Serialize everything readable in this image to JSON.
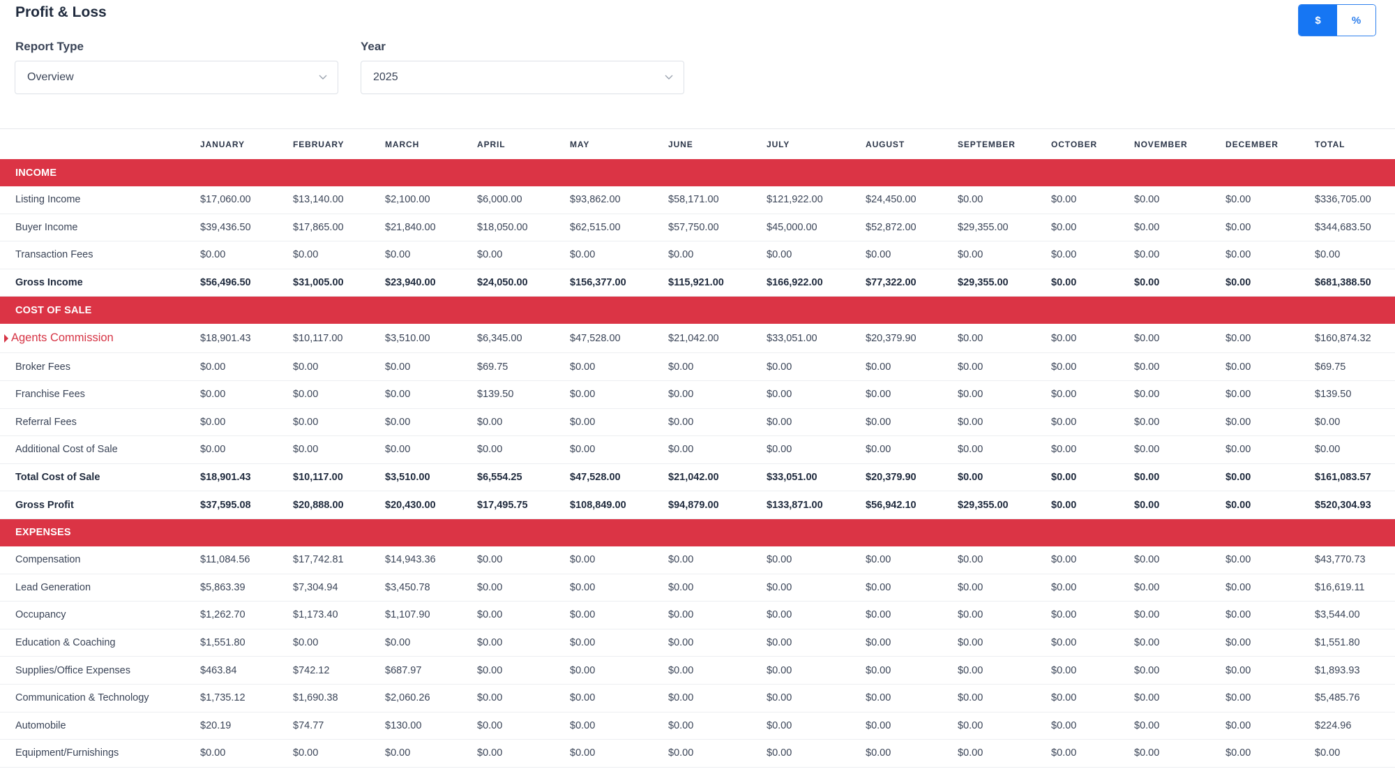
{
  "page": {
    "title": "Profit & Loss"
  },
  "toggle": {
    "dollar_label": "$",
    "percent_label": "%",
    "active": "$"
  },
  "filters": {
    "report_type_label": "Report Type",
    "report_type_value": "Overview",
    "year_label": "Year",
    "year_value": "2025"
  },
  "table": {
    "columns": [
      "JANUARY",
      "FEBRUARY",
      "MARCH",
      "APRIL",
      "MAY",
      "JUNE",
      "JULY",
      "AUGUST",
      "SEPTEMBER",
      "OCTOBER",
      "NOVEMBER",
      "DECEMBER",
      "TOTAL"
    ],
    "rows": [
      {
        "kind": "section",
        "label": "INCOME"
      },
      {
        "kind": "data",
        "label": "Listing Income",
        "values": [
          "$17,060.00",
          "$13,140.00",
          "$2,100.00",
          "$6,000.00",
          "$93,862.00",
          "$58,171.00",
          "$121,922.00",
          "$24,450.00",
          "$0.00",
          "$0.00",
          "$0.00",
          "$0.00",
          "$336,705.00"
        ]
      },
      {
        "kind": "data",
        "label": "Buyer Income",
        "values": [
          "$39,436.50",
          "$17,865.00",
          "$21,840.00",
          "$18,050.00",
          "$62,515.00",
          "$57,750.00",
          "$45,000.00",
          "$52,872.00",
          "$29,355.00",
          "$0.00",
          "$0.00",
          "$0.00",
          "$344,683.50"
        ]
      },
      {
        "kind": "data",
        "label": "Transaction Fees",
        "values": [
          "$0.00",
          "$0.00",
          "$0.00",
          "$0.00",
          "$0.00",
          "$0.00",
          "$0.00",
          "$0.00",
          "$0.00",
          "$0.00",
          "$0.00",
          "$0.00",
          "$0.00"
        ]
      },
      {
        "kind": "total",
        "label": "Gross Income",
        "values": [
          "$56,496.50",
          "$31,005.00",
          "$23,940.00",
          "$24,050.00",
          "$156,377.00",
          "$115,921.00",
          "$166,922.00",
          "$77,322.00",
          "$29,355.00",
          "$0.00",
          "$0.00",
          "$0.00",
          "$681,388.50"
        ]
      },
      {
        "kind": "section",
        "label": "COST OF SALE"
      },
      {
        "kind": "expandable",
        "label": "Agents Commission",
        "values": [
          "$18,901.43",
          "$10,117.00",
          "$3,510.00",
          "$6,345.00",
          "$47,528.00",
          "$21,042.00",
          "$33,051.00",
          "$20,379.90",
          "$0.00",
          "$0.00",
          "$0.00",
          "$0.00",
          "$160,874.32"
        ]
      },
      {
        "kind": "data",
        "label": "Broker Fees",
        "values": [
          "$0.00",
          "$0.00",
          "$0.00",
          "$69.75",
          "$0.00",
          "$0.00",
          "$0.00",
          "$0.00",
          "$0.00",
          "$0.00",
          "$0.00",
          "$0.00",
          "$69.75"
        ]
      },
      {
        "kind": "data",
        "label": "Franchise Fees",
        "values": [
          "$0.00",
          "$0.00",
          "$0.00",
          "$139.50",
          "$0.00",
          "$0.00",
          "$0.00",
          "$0.00",
          "$0.00",
          "$0.00",
          "$0.00",
          "$0.00",
          "$139.50"
        ]
      },
      {
        "kind": "data",
        "label": "Referral Fees",
        "values": [
          "$0.00",
          "$0.00",
          "$0.00",
          "$0.00",
          "$0.00",
          "$0.00",
          "$0.00",
          "$0.00",
          "$0.00",
          "$0.00",
          "$0.00",
          "$0.00",
          "$0.00"
        ]
      },
      {
        "kind": "data",
        "label": "Additional Cost of Sale",
        "values": [
          "$0.00",
          "$0.00",
          "$0.00",
          "$0.00",
          "$0.00",
          "$0.00",
          "$0.00",
          "$0.00",
          "$0.00",
          "$0.00",
          "$0.00",
          "$0.00",
          "$0.00"
        ]
      },
      {
        "kind": "total",
        "label": "Total Cost of Sale",
        "values": [
          "$18,901.43",
          "$10,117.00",
          "$3,510.00",
          "$6,554.25",
          "$47,528.00",
          "$21,042.00",
          "$33,051.00",
          "$20,379.90",
          "$0.00",
          "$0.00",
          "$0.00",
          "$0.00",
          "$161,083.57"
        ]
      },
      {
        "kind": "total",
        "label": "Gross Profit",
        "values": [
          "$37,595.08",
          "$20,888.00",
          "$20,430.00",
          "$17,495.75",
          "$108,849.00",
          "$94,879.00",
          "$133,871.00",
          "$56,942.10",
          "$29,355.00",
          "$0.00",
          "$0.00",
          "$0.00",
          "$520,304.93"
        ]
      },
      {
        "kind": "section",
        "label": "EXPENSES"
      },
      {
        "kind": "data",
        "label": "Compensation",
        "values": [
          "$11,084.56",
          "$17,742.81",
          "$14,943.36",
          "$0.00",
          "$0.00",
          "$0.00",
          "$0.00",
          "$0.00",
          "$0.00",
          "$0.00",
          "$0.00",
          "$0.00",
          "$43,770.73"
        ]
      },
      {
        "kind": "data",
        "label": "Lead Generation",
        "values": [
          "$5,863.39",
          "$7,304.94",
          "$3,450.78",
          "$0.00",
          "$0.00",
          "$0.00",
          "$0.00",
          "$0.00",
          "$0.00",
          "$0.00",
          "$0.00",
          "$0.00",
          "$16,619.11"
        ]
      },
      {
        "kind": "data",
        "label": "Occupancy",
        "values": [
          "$1,262.70",
          "$1,173.40",
          "$1,107.90",
          "$0.00",
          "$0.00",
          "$0.00",
          "$0.00",
          "$0.00",
          "$0.00",
          "$0.00",
          "$0.00",
          "$0.00",
          "$3,544.00"
        ]
      },
      {
        "kind": "data",
        "label": "Education & Coaching",
        "values": [
          "$1,551.80",
          "$0.00",
          "$0.00",
          "$0.00",
          "$0.00",
          "$0.00",
          "$0.00",
          "$0.00",
          "$0.00",
          "$0.00",
          "$0.00",
          "$0.00",
          "$1,551.80"
        ]
      },
      {
        "kind": "data",
        "label": "Supplies/Office Expenses",
        "values": [
          "$463.84",
          "$742.12",
          "$687.97",
          "$0.00",
          "$0.00",
          "$0.00",
          "$0.00",
          "$0.00",
          "$0.00",
          "$0.00",
          "$0.00",
          "$0.00",
          "$1,893.93"
        ]
      },
      {
        "kind": "data",
        "label": "Communication & Technology",
        "values": [
          "$1,735.12",
          "$1,690.38",
          "$2,060.26",
          "$0.00",
          "$0.00",
          "$0.00",
          "$0.00",
          "$0.00",
          "$0.00",
          "$0.00",
          "$0.00",
          "$0.00",
          "$5,485.76"
        ]
      },
      {
        "kind": "data",
        "label": "Automobile",
        "values": [
          "$20.19",
          "$74.77",
          "$130.00",
          "$0.00",
          "$0.00",
          "$0.00",
          "$0.00",
          "$0.00",
          "$0.00",
          "$0.00",
          "$0.00",
          "$0.00",
          "$224.96"
        ]
      },
      {
        "kind": "data",
        "label": "Equipment/Furnishings",
        "values": [
          "$0.00",
          "$0.00",
          "$0.00",
          "$0.00",
          "$0.00",
          "$0.00",
          "$0.00",
          "$0.00",
          "$0.00",
          "$0.00",
          "$0.00",
          "$0.00",
          "$0.00"
        ]
      }
    ]
  },
  "colors": {
    "section_red": "#db3445",
    "accent_blue": "#1676f3",
    "link_red": "#d63445"
  }
}
